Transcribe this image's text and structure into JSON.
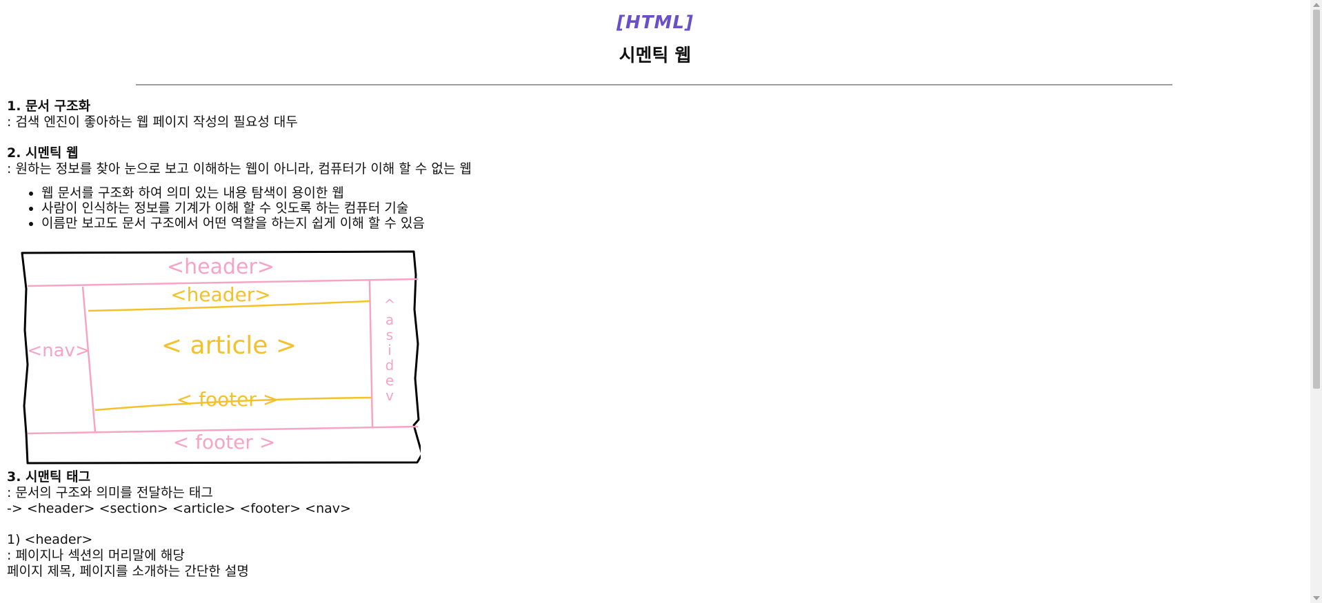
{
  "header": {
    "tag": "[HTML]",
    "title": "시멘틱 웹"
  },
  "sections": {
    "s1_title": "1. 문서 구조화",
    "s1_desc": ": 검색 엔진이 좋아하는 웹 페이지 작성의 필요성 대두",
    "s2_title": "2. 시멘틱 웹",
    "s2_desc": ": 원하는 정보를 찾아 눈으로 보고 이해하는 웹이 아니라, 컴퓨터가 이해 할 수 없는 웹",
    "s2_bullets": [
      "웹 문서를 구조화 하여 의미 있는 내용 탐색이 용이한 웹",
      "사람이 인식하는 정보를 기계가 이해 할 수 잇도록 하는 컴퓨터 기술",
      "이름만 보고도 문서 구조에서 어떤 역할을 하는지 쉽게 이해 할 수 있음"
    ],
    "s3_title": "3. 시맨틱 태그",
    "s3_desc": ": 문서의 구조와 의미를 전달하는 태그",
    "s3_tags": "-> <header> <section> <article> <footer> <nav>",
    "h1_title": "1) <header>",
    "h1_desc": ": 페이지나 섹션의 머리말에 해당",
    "h1_detail": "페이지 제목, 페이지를 소개하는 간단한 설명"
  },
  "diagram": {
    "outer_header": "<header>",
    "inner_header": "<header>",
    "article": "< article >",
    "inner_footer": "< footer >",
    "outer_footer": "< footer >",
    "nav": "<nav>",
    "aside_letters": [
      "^",
      "a",
      "s",
      "i",
      "d",
      "e",
      "v"
    ],
    "colors": {
      "pink": "#f7a3c4",
      "yellow": "#f5c02a",
      "frame": "#000000"
    }
  }
}
